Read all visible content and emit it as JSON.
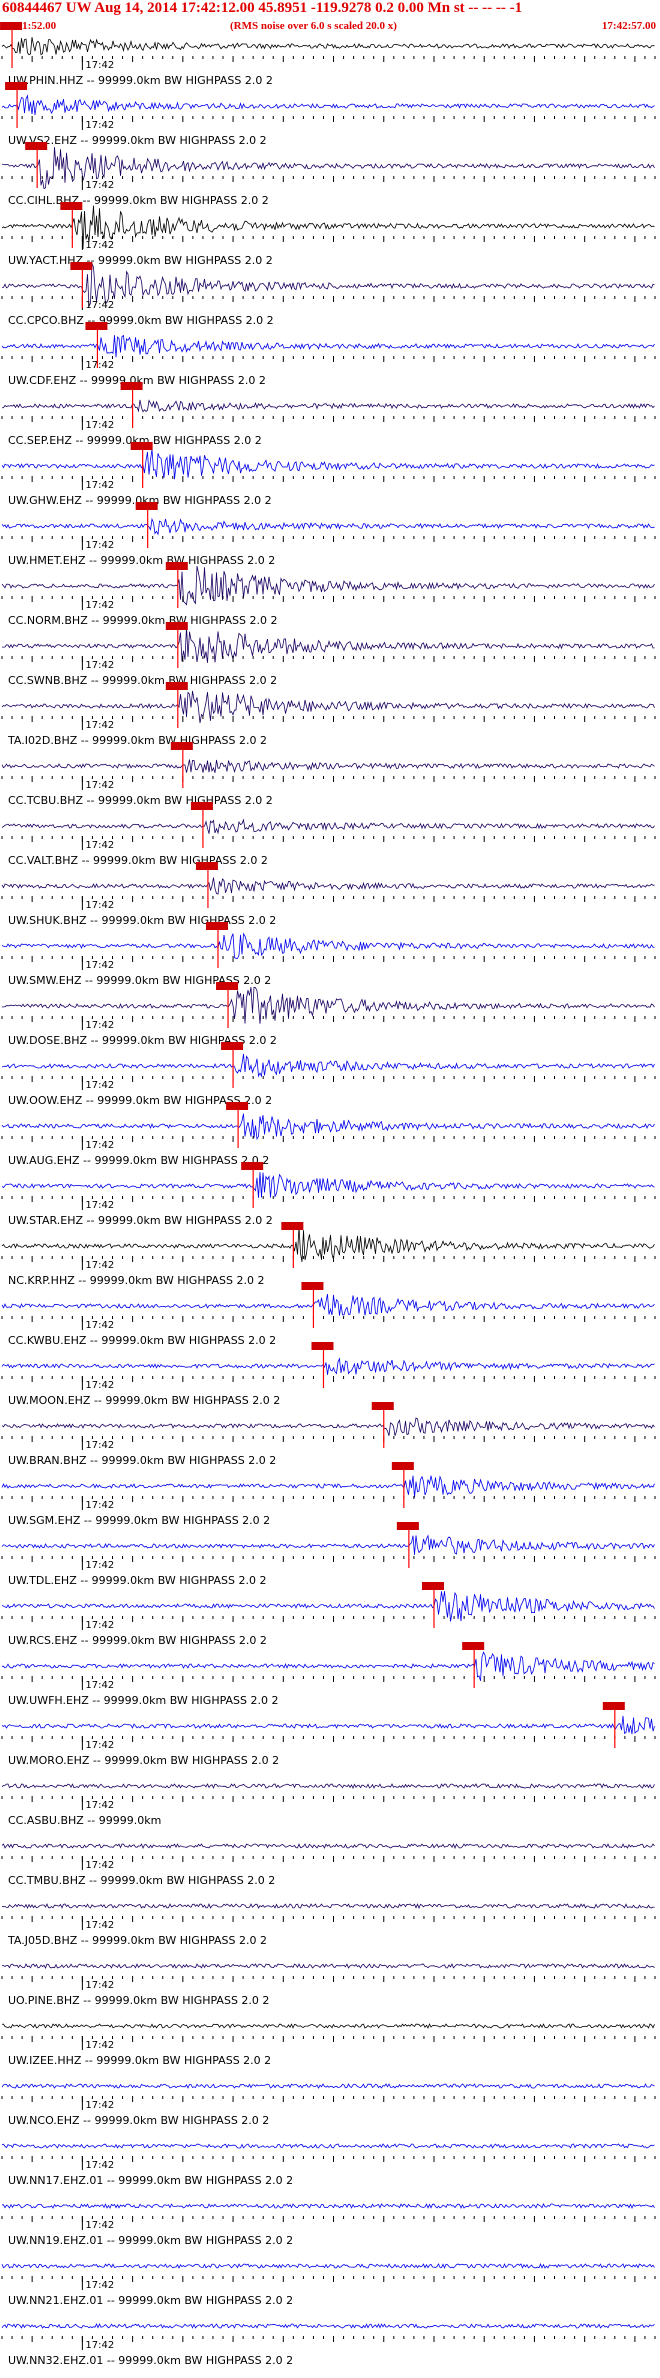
{
  "header": {
    "title": "60844467 UW Aug 14, 2014 17:42:12.00   45.8951 -119.9278  0.2 0.00 Mn st -- -- --  -1",
    "start_time": "17:41:52.00",
    "noise_note": "(RMS noise over 6.0 s scaled 20.0 x)",
    "end_time": "17:42:57.00"
  },
  "colors": {
    "header_text": "#e00000",
    "pick": "#ff0000",
    "tick": "#000000",
    "trace_palette": [
      "#000000",
      "#1a0060",
      "#0000ee"
    ]
  },
  "chart_data": {
    "type": "line",
    "title": "60844467 UW Aug 14, 2014 17:42:12.00   45.8951 -119.9278  0.2 0.00 Mn st -- -- --  -1",
    "time_start": "17:41:52.00",
    "time_end": "17:42:57.00",
    "tick_minute_label": "17:42",
    "grid": false,
    "traces": [
      {
        "name": "UW.PHIN.HHZ -- 99999.0km BW  HIGHPASS  2.0  2",
        "pick_time": "17:41:53.00",
        "color": "#000000",
        "amp": 0.5
      },
      {
        "name": "UW.VS2.EHZ -- 99999.0km BW  HIGHPASS  2.0  2",
        "pick_time": "17:41:53.50",
        "color": "#0000ee",
        "amp": 0.4
      },
      {
        "name": "CC.CIHL.BHZ -- 99999.0km BW  HIGHPASS  2.0  2",
        "pick_time": "17:41:55.50",
        "color": "#1a0060",
        "amp": 1.0
      },
      {
        "name": "UW.YACT.HHZ -- 99999.0km BW  HIGHPASS  2.0  2",
        "pick_time": "17:41:59.00",
        "color": "#000000",
        "amp": 1.0
      },
      {
        "name": "CC.CPCO.BHZ -- 99999.0km BW  HIGHPASS  2.0  2",
        "pick_time": "17:42:00.00",
        "color": "#1a0060",
        "amp": 1.0
      },
      {
        "name": "UW.CDF.EHZ -- 99999.0km BW  HIGHPASS  2.0  2",
        "pick_time": "17:42:01.50",
        "color": "#0000ee",
        "amp": 0.5
      },
      {
        "name": "CC.SEP.EHZ -- 99999.0km BW  HIGHPASS  2.0  2",
        "pick_time": "17:42:05.00",
        "color": "#1a0060",
        "amp": 0.2
      },
      {
        "name": "UW.GHW.EHZ -- 99999.0km BW  HIGHPASS  2.0  2",
        "pick_time": "17:42:06.00",
        "color": "#0000ee",
        "amp": 0.8
      },
      {
        "name": "UW.HMET.EHZ -- 99999.0km BW  HIGHPASS  2.0  2",
        "pick_time": "17:42:06.50",
        "color": "#0000ee",
        "amp": 0.3
      },
      {
        "name": "CC.NORM.BHZ -- 99999.0km BW  HIGHPASS  2.0  2",
        "pick_time": "17:42:09.50",
        "color": "#1a0060",
        "amp": 1.0
      },
      {
        "name": "CC.SWNB.BHZ -- 99999.0km BW  HIGHPASS  2.0  2",
        "pick_time": "17:42:09.50",
        "color": "#1a0060",
        "amp": 1.0
      },
      {
        "name": "TA.I02D.BHZ -- 99999.0km BW  HIGHPASS  2.0  2",
        "pick_time": "17:42:09.50",
        "color": "#1a0060",
        "amp": 0.9
      },
      {
        "name": "CC.TCBU.BHZ -- 99999.0km BW  HIGHPASS  2.0  2",
        "pick_time": "17:42:10.00",
        "color": "#1a0060",
        "amp": 0.3
      },
      {
        "name": "CC.VALT.BHZ -- 99999.0km BW  HIGHPASS  2.0  2",
        "pick_time": "17:42:12.00",
        "color": "#1a0060",
        "amp": 0.3
      },
      {
        "name": "UW.SHUK.BHZ -- 99999.0km BW  HIGHPASS  2.0  2",
        "pick_time": "17:42:12.50",
        "color": "#1a0060",
        "amp": 0.3
      },
      {
        "name": "UW.SMW.EHZ -- 99999.0km BW  HIGHPASS  2.0  2",
        "pick_time": "17:42:13.50",
        "color": "#0000ee",
        "amp": 0.6
      },
      {
        "name": "UW.DOSE.BHZ -- 99999.0km BW  HIGHPASS  2.0  2",
        "pick_time": "17:42:14.50",
        "color": "#1a0060",
        "amp": 1.0
      },
      {
        "name": "UW.OOW.EHZ -- 99999.0km BW  HIGHPASS  2.0  2",
        "pick_time": "17:42:15.00",
        "color": "#0000ee",
        "amp": 0.5
      },
      {
        "name": "UW.AUG.EHZ -- 99999.0km BW  HIGHPASS  2.0  2",
        "pick_time": "17:42:15.50",
        "color": "#0000ee",
        "amp": 0.6
      },
      {
        "name": "UW.STAR.EHZ -- 99999.0km BW  HIGHPASS  2.0  2",
        "pick_time": "17:42:17.00",
        "color": "#0000ee",
        "amp": 0.6
      },
      {
        "name": "NC.KRP.HHZ -- 99999.0km BW  HIGHPASS  2.0  2",
        "pick_time": "17:42:21.00",
        "color": "#000000",
        "amp": 0.8
      },
      {
        "name": "CC.KWBU.EHZ -- 99999.0km BW  HIGHPASS  2.0  2",
        "pick_time": "17:42:23.00",
        "color": "#0000ee",
        "amp": 0.6
      },
      {
        "name": "UW.MOON.EHZ -- 99999.0km BW  HIGHPASS  2.0  2",
        "pick_time": "17:42:24.00",
        "color": "#0000ee",
        "amp": 0.4
      },
      {
        "name": "UW.BRAN.BHZ -- 99999.0km BW  HIGHPASS  2.0  2",
        "pick_time": "17:42:30.00",
        "color": "#1a0060",
        "amp": 0.4
      },
      {
        "name": "UW.SGM.EHZ -- 99999.0km BW  HIGHPASS  2.0  2",
        "pick_time": "17:42:32.00",
        "color": "#0000ee",
        "amp": 0.5
      },
      {
        "name": "UW.TDL.EHZ -- 99999.0km BW  HIGHPASS  2.0  2",
        "pick_time": "17:42:32.50",
        "color": "#0000ee",
        "amp": 0.5
      },
      {
        "name": "UW.RCS.EHZ -- 99999.0km BW  HIGHPASS  2.0  2",
        "pick_time": "17:42:35.00",
        "color": "#0000ee",
        "amp": 0.8
      },
      {
        "name": "UW.UWFH.EHZ -- 99999.0km BW  HIGHPASS  2.0  2",
        "pick_time": "17:42:39.00",
        "color": "#0000ee",
        "amp": 0.6
      },
      {
        "name": "UW.MORO.EHZ -- 99999.0km BW  HIGHPASS  2.0  2",
        "pick_time": "17:42:53.00",
        "color": "#0000ee",
        "amp": 0.4
      },
      {
        "name": "CC.ASBU.BHZ -- 99999.0km",
        "pick_time": "",
        "color": "#1a0060",
        "amp": 0.1
      },
      {
        "name": "CC.TMBU.BHZ -- 99999.0km BW  HIGHPASS  2.0  2",
        "pick_time": "",
        "color": "#1a0060",
        "amp": 0.2
      },
      {
        "name": "TA.J05D.BHZ -- 99999.0km BW  HIGHPASS  2.0  2",
        "pick_time": "",
        "color": "#1a0060",
        "amp": 0.2
      },
      {
        "name": "UO.PINE.BHZ -- 99999.0km BW  HIGHPASS  2.0  2",
        "pick_time": "",
        "color": "#1a0060",
        "amp": 0.2
      },
      {
        "name": "UW.IZEE.HHZ -- 99999.0km BW  HIGHPASS  2.0  2",
        "pick_time": "",
        "color": "#000000",
        "amp": 0.3
      },
      {
        "name": "UW.NCO.EHZ -- 99999.0km BW  HIGHPASS  2.0  2",
        "pick_time": "",
        "color": "#0000ee",
        "amp": 0.1
      },
      {
        "name": "UW.NN17.EHZ.01 -- 99999.0km BW  HIGHPASS  2.0  2",
        "pick_time": "",
        "color": "#0000ee",
        "amp": 0.3
      },
      {
        "name": "UW.NN19.EHZ.01 -- 99999.0km BW  HIGHPASS  2.0  2",
        "pick_time": "",
        "color": "#0000ee",
        "amp": 0.3
      },
      {
        "name": "UW.NN21.EHZ.01 -- 99999.0km BW  HIGHPASS  2.0  2",
        "pick_time": "",
        "color": "#0000ee",
        "amp": 0.4
      },
      {
        "name": "UW.NN32.EHZ.01 -- 99999.0km BW  HIGHPASS  2.0  2",
        "pick_time": "",
        "color": "#0000ee",
        "amp": 0.4
      }
    ]
  }
}
